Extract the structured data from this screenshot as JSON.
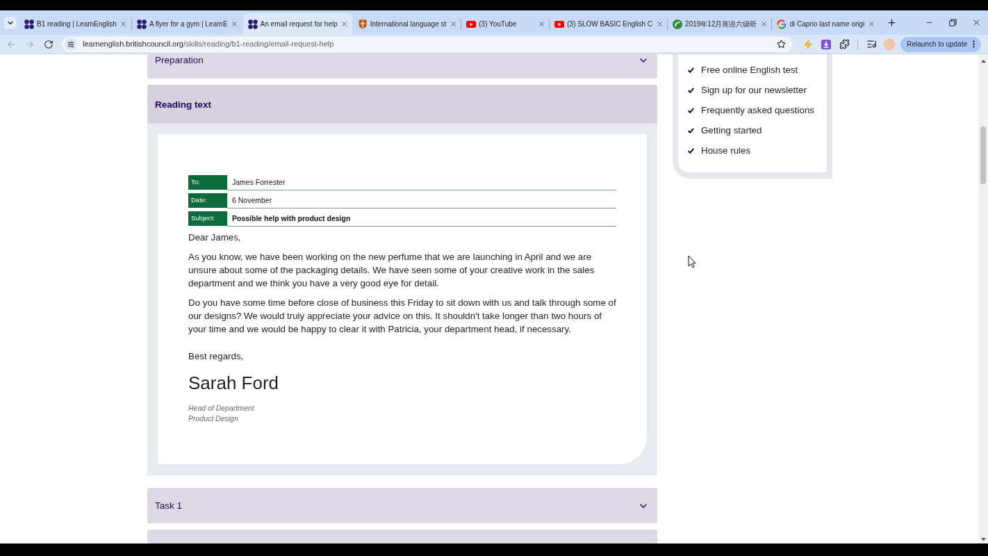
{
  "browser": {
    "tabs": [
      {
        "title": "B1 reading | LearnEnglish",
        "kind": "clover",
        "selected": false
      },
      {
        "title": "A flyer for a gym | LearnE",
        "kind": "clover",
        "selected": false
      },
      {
        "title": "An email request for help",
        "kind": "clover",
        "selected": true
      },
      {
        "title": "International language st",
        "kind": "shield",
        "selected": false
      },
      {
        "title": "(3) YouTube",
        "kind": "video",
        "selected": false
      },
      {
        "title": "(3) SLOW BASIC English C",
        "kind": "video",
        "selected": false
      },
      {
        "title": "2019年12月英语六级听",
        "kind": "round-logo",
        "selected": false
      },
      {
        "title": "di Caprio last name origi",
        "kind": "ring-logo",
        "selected": false
      }
    ],
    "nav_buttons": [
      {
        "kind": "back",
        "disabled": true
      },
      {
        "kind": "forward",
        "disabled": true
      },
      {
        "kind": "reload",
        "disabled": false
      }
    ],
    "address_bar": {
      "host": "learnenglish.britishcouncil.org",
      "path": "/skills/reading/b1-reading/email-request-help"
    },
    "update_button": "Relaunch to update"
  },
  "sections": [
    {
      "title": "Preparation",
      "expanded": false
    },
    {
      "title": "Reading text",
      "expanded": true,
      "email": {
        "fields": [
          {
            "label": "To:",
            "value": "James Forrester",
            "kind": "recipient"
          },
          {
            "label": "Date:",
            "value": "6 November",
            "kind": "date"
          },
          {
            "label": "Subject:",
            "value": "Possible help with product design",
            "kind": "subject"
          }
        ],
        "greeting": "Dear James,",
        "paragraphs": [
          "As you know, we have been working on the new perfume that we are launching in April and we are unsure about some of the packaging details. We have seen some of your creative work in the sales department and we think you have a very good eye for detail.",
          "Do you have some time before close of business this Friday to sit down with us and talk through some of our designs? We would truly appreciate your advice on this. It shouldn't take longer than two hours of your time and we would be happy to clear it with Patricia, your department head, if necessary."
        ],
        "closing": "Best regards,",
        "signature": "Sarah Ford",
        "signature_lines": [
          "Head of Department",
          "Product Design"
        ]
      }
    },
    {
      "title": "Task 1",
      "expanded": false
    },
    {
      "expanded": false
    }
  ],
  "sidebar_links": [
    "Free online English test",
    "Sign up for our newsletter",
    "Frequently asked questions",
    "Getting started",
    "House rules"
  ]
}
